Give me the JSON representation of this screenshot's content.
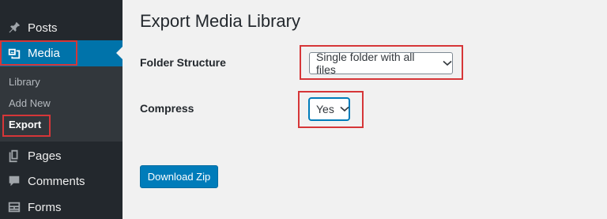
{
  "sidebar": {
    "items": [
      {
        "label": "Posts",
        "icon": "pin-icon"
      },
      {
        "label": "Media",
        "icon": "media-icon"
      },
      {
        "label": "Pages",
        "icon": "pages-icon"
      },
      {
        "label": "Comments",
        "icon": "comment-icon"
      },
      {
        "label": "Forms",
        "icon": "forms-icon"
      }
    ],
    "submenu": {
      "library": "Library",
      "add_new": "Add New",
      "export": "Export"
    },
    "active_color": "#0073aa",
    "background_color": "#23282d"
  },
  "main": {
    "title": "Export Media Library",
    "folder_structure": {
      "label": "Folder Structure",
      "value": "Single folder with all files"
    },
    "compress": {
      "label": "Compress",
      "value": "Yes"
    },
    "download_button": "Download Zip"
  },
  "highlight_color": "#d63638"
}
